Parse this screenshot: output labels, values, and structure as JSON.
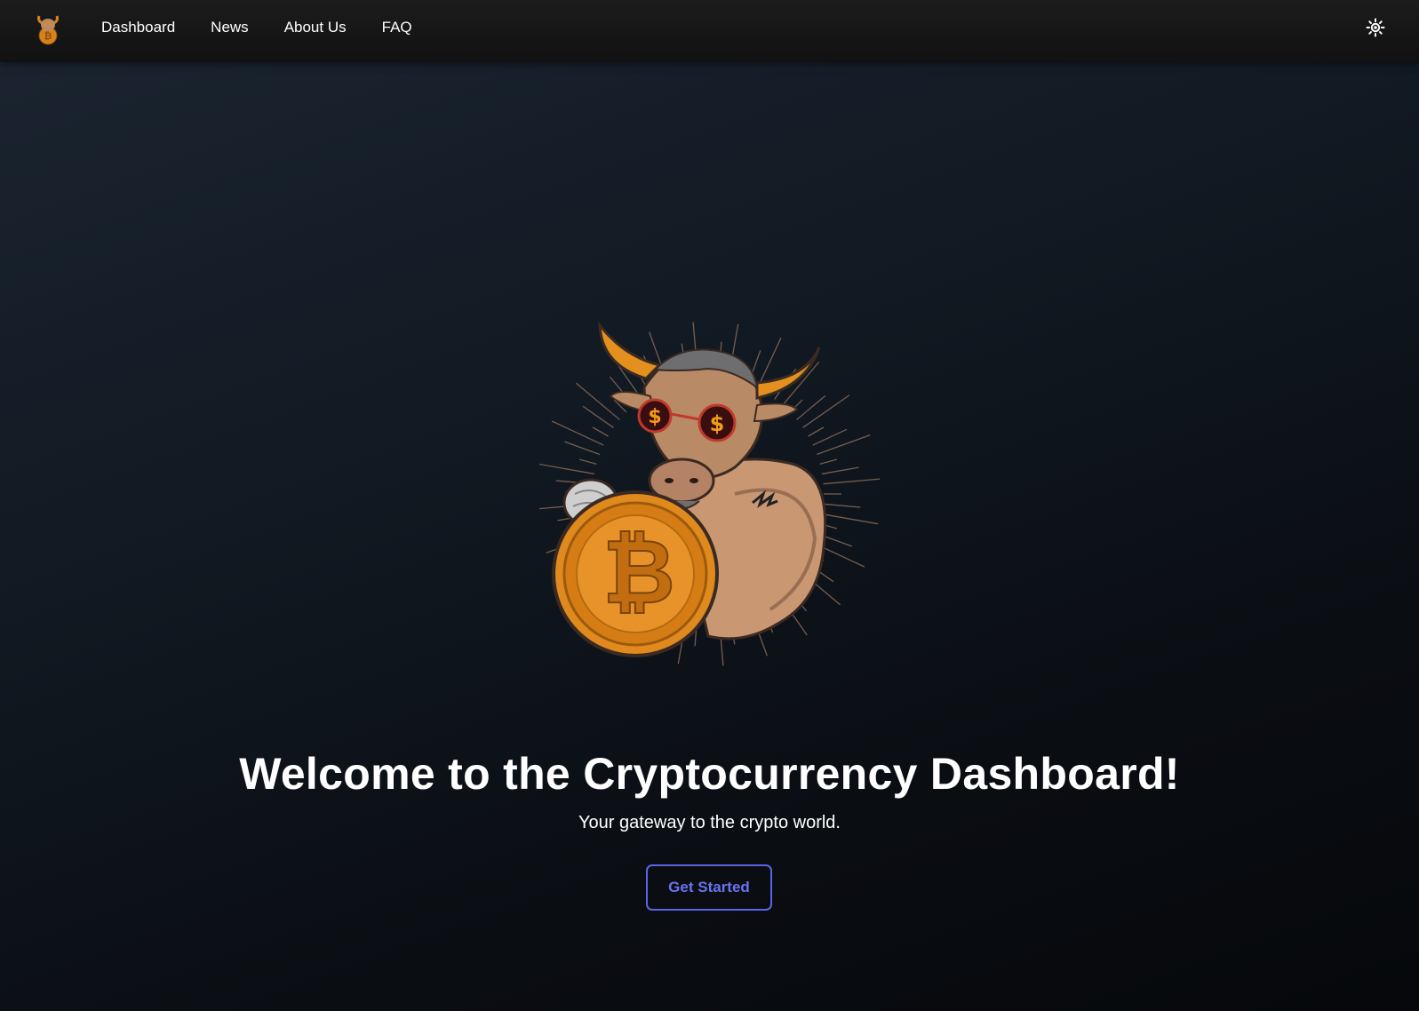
{
  "nav": {
    "logo_icon": "bull-bitcoin-logo-icon",
    "links": [
      {
        "label": "Dashboard"
      },
      {
        "label": "News"
      },
      {
        "label": "About Us"
      },
      {
        "label": "FAQ"
      }
    ],
    "theme_toggle_icon": "sun-icon"
  },
  "hero": {
    "image_icon": "bull-with-bitcoin-illustration",
    "title": "Welcome to the Cryptocurrency Dashboard!",
    "subtitle": "Your gateway to the crypto world.",
    "cta_label": "Get Started"
  },
  "colors": {
    "accent": "#5c64e6",
    "navbar_bg": "#161617",
    "page_bg_top": "#1b2531",
    "page_bg_bottom": "#06080b",
    "coin_orange": "#e08a1e"
  }
}
